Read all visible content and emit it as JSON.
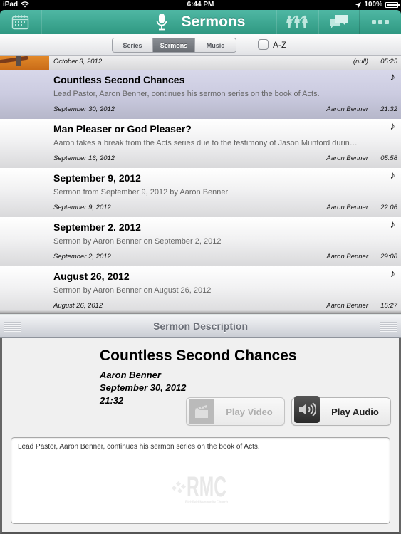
{
  "status_bar": {
    "device": "iPad",
    "time": "6:44 PM",
    "battery": "100%"
  },
  "nav": {
    "title": "Sermons",
    "buttons": [
      {
        "name": "calendar",
        "icon": "calendar-icon"
      },
      {
        "name": "community",
        "icon": "people-icon"
      },
      {
        "name": "messages",
        "icon": "chat-bubbles-icon"
      },
      {
        "name": "more",
        "icon": "ellipsis-icon"
      }
    ]
  },
  "toolbar": {
    "segments": [
      "Series",
      "Sermons",
      "Music"
    ],
    "active_segment": "Sermons",
    "az_label": "A-Z",
    "az_checked": false
  },
  "list": {
    "partial_item": {
      "date": "October 3, 2012",
      "speaker": "(null)",
      "duration": "05:25"
    },
    "items": [
      {
        "title": "Countless Second Chances",
        "description": "Lead Pastor, Aaron Benner, continues his sermon series on the book of Acts.",
        "date": "September 30, 2012",
        "speaker": "Aaron Benner",
        "duration": "21:32",
        "icon": "music-note-icon",
        "selected": true
      },
      {
        "title": "Man Pleaser or God Pleaser?",
        "description": "Aaron takes a break from the Acts series due to the testimony of Jason Munford durin…",
        "date": "September 16, 2012",
        "speaker": "Aaron Benner",
        "duration": "05:58",
        "icon": "music-note-icon",
        "selected": false
      },
      {
        "title": "September 9, 2012",
        "description": "Sermon from September 9, 2012 by Aaron Benner",
        "date": "September 9, 2012",
        "speaker": "Aaron Benner",
        "duration": "22:06",
        "icon": "music-note-icon",
        "selected": false
      },
      {
        "title": "September 2. 2012",
        "description": "Sermon by Aaron Benner on September 2, 2012",
        "date": "September 2, 2012",
        "speaker": "Aaron Benner",
        "duration": "29:08",
        "icon": "music-note-icon",
        "selected": false
      },
      {
        "title": "August 26, 2012",
        "description": "Sermon by Aaron Benner on August 26, 2012",
        "date": "August 26, 2012",
        "speaker": "Aaron Benner",
        "duration": "15:27",
        "icon": "music-note-icon",
        "selected": false
      }
    ]
  },
  "description_panel": {
    "header": "Sermon Description",
    "title": "Countless Second Chances",
    "speaker": "Aaron Benner",
    "date": "September 30, 2012",
    "duration": "21:32",
    "play_video_label": "Play Video",
    "play_video_enabled": false,
    "play_audio_label": "Play Audio",
    "play_audio_enabled": true,
    "body": "Lead Pastor, Aaron Benner, continues his sermon series on the book of Acts.",
    "watermark": {
      "logo": "RMC",
      "tagline": "Richfield Mennonite Church"
    }
  }
}
